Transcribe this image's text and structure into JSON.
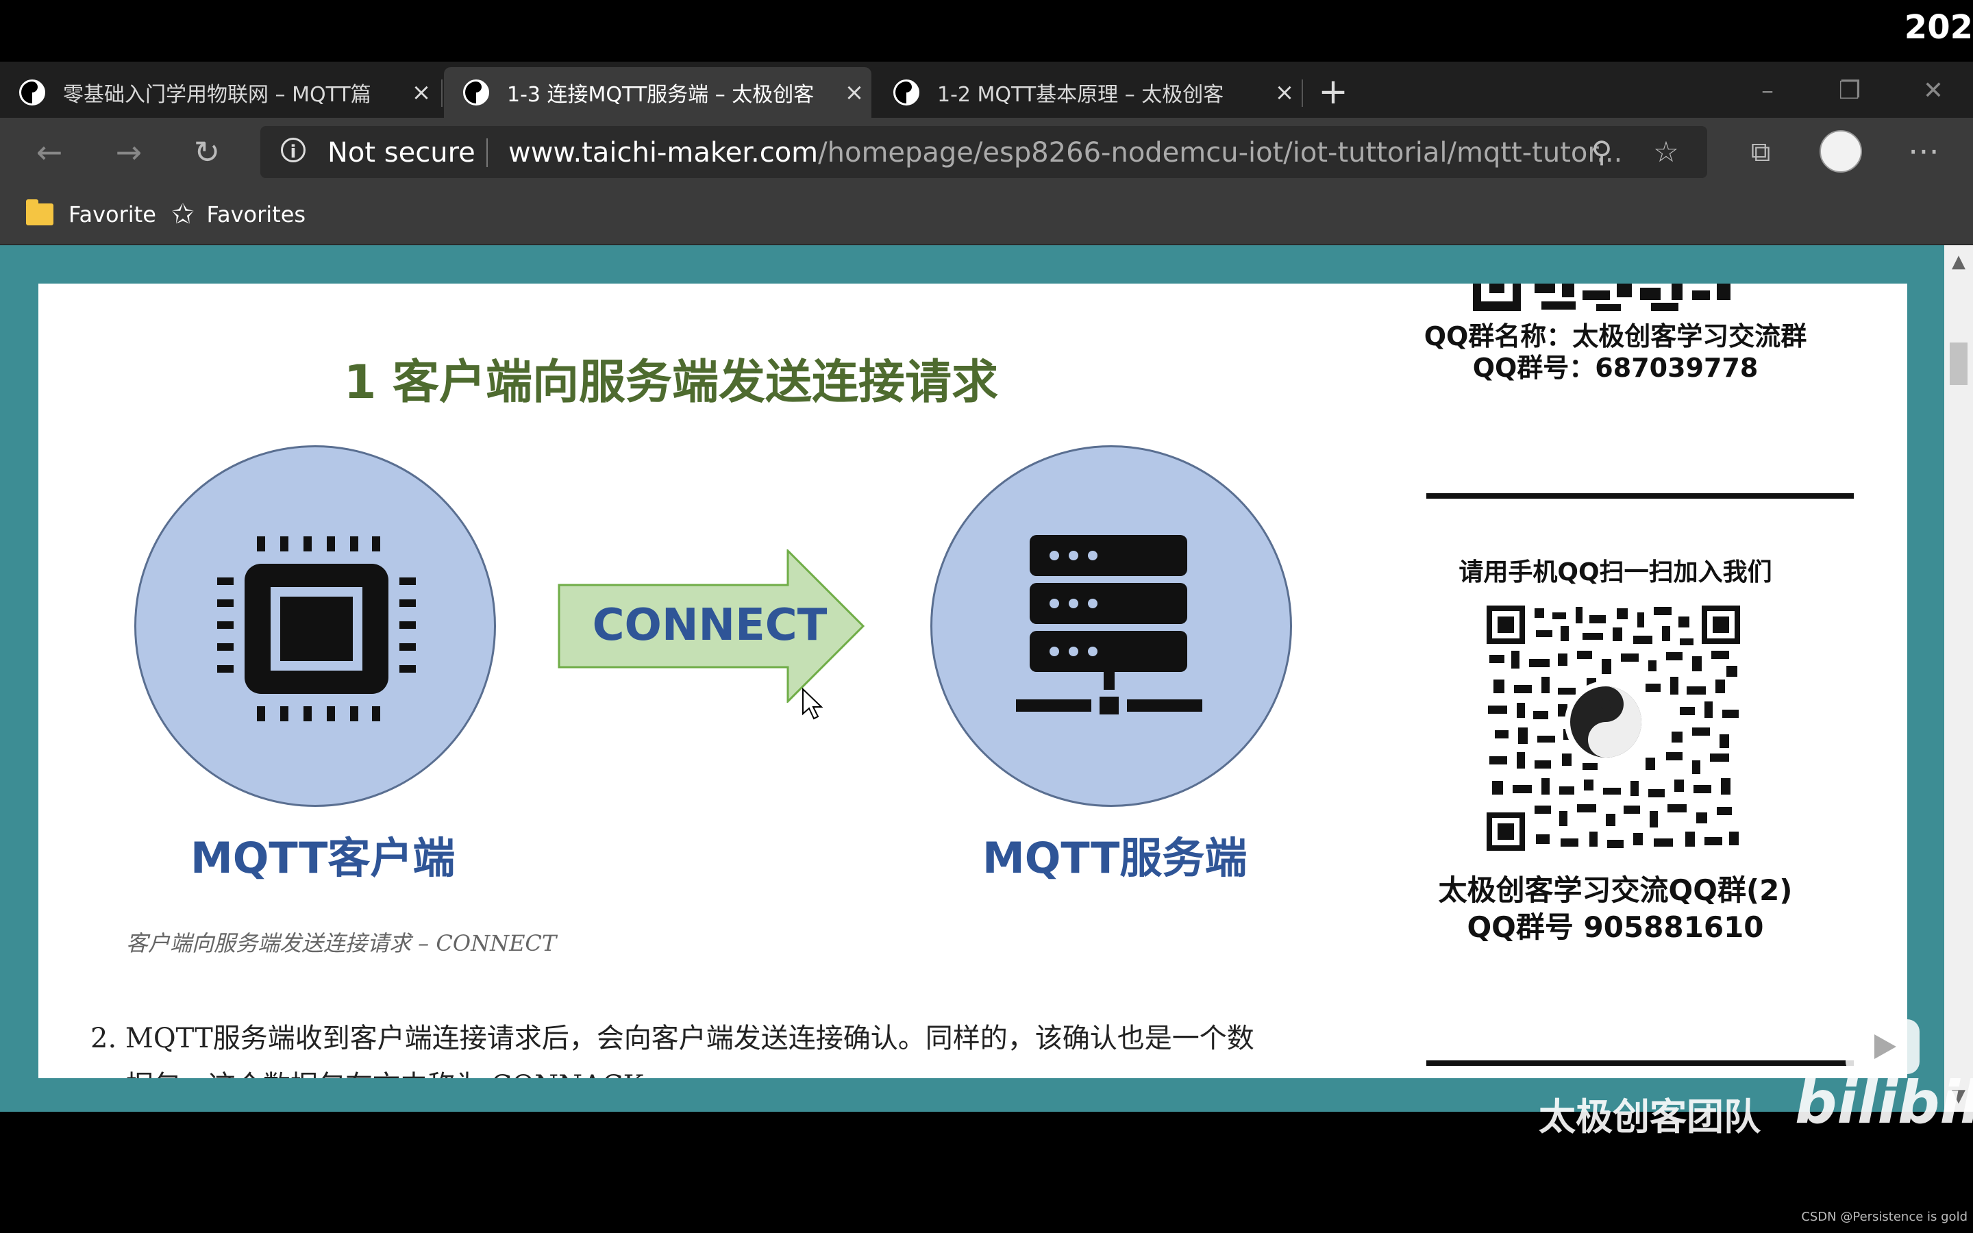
{
  "corner_year": "202",
  "tabs": [
    {
      "title": "零基础入门学用物联网 – MQTT篇",
      "active": false
    },
    {
      "title": "1-3 连接MQTT服务端 – 太极创客",
      "active": true
    },
    {
      "title": "1-2 MQTT基本原理 – 太极创客",
      "active": false
    }
  ],
  "tab_close_glyph": "×",
  "new_tab_glyph": "+",
  "toolbar": {
    "security_label": "Not secure",
    "info_glyph": "i",
    "url_domain": "www.taichi-maker.com",
    "url_path": "/homepage/esp8266-nodemcu-iot/iot-tuttorial/mqtt-tutor..."
  },
  "bookmarks": [
    {
      "label": "Favorite",
      "icon": "folder-icon"
    },
    {
      "label": "Favorites",
      "icon": "favorites-star-icon"
    }
  ],
  "figure": {
    "title": "1 客户端向服务端发送连接请求",
    "arrow_label": "CONNECT",
    "client_label": "MQTT客户端",
    "server_label": "MQTT服务端",
    "caption": "客户端向服务端发送连接请求 – CONNECT"
  },
  "paragraph": {
    "number": "2.",
    "text": "MQTT服务端收到客户端连接请求后，会向客户端发送连接确认。同样的，该确认也是一个数",
    "line2": "据包，这个数据包在文中称为 CONNACK"
  },
  "sidebar": {
    "qq_group_name": "QQ群名称：太极创客学习交流群",
    "qq_group_number": "QQ群号：687039778",
    "scan_prompt": "请用手机QQ扫一扫加入我们",
    "group2_name": "太极创客学习交流QQ群(2)",
    "group2_number": "QQ群号 905881610"
  },
  "watermark": {
    "team": "太极创客团队",
    "logo": "bilibili",
    "credit": "CSDN @Persistence is gold"
  },
  "colors": {
    "page_background": "#3d8d94",
    "circle_fill": "#b4c7e7",
    "arrow_fill": "#c5e0b4",
    "title_green": "#4e6b2f",
    "label_blue": "#2f5597"
  }
}
